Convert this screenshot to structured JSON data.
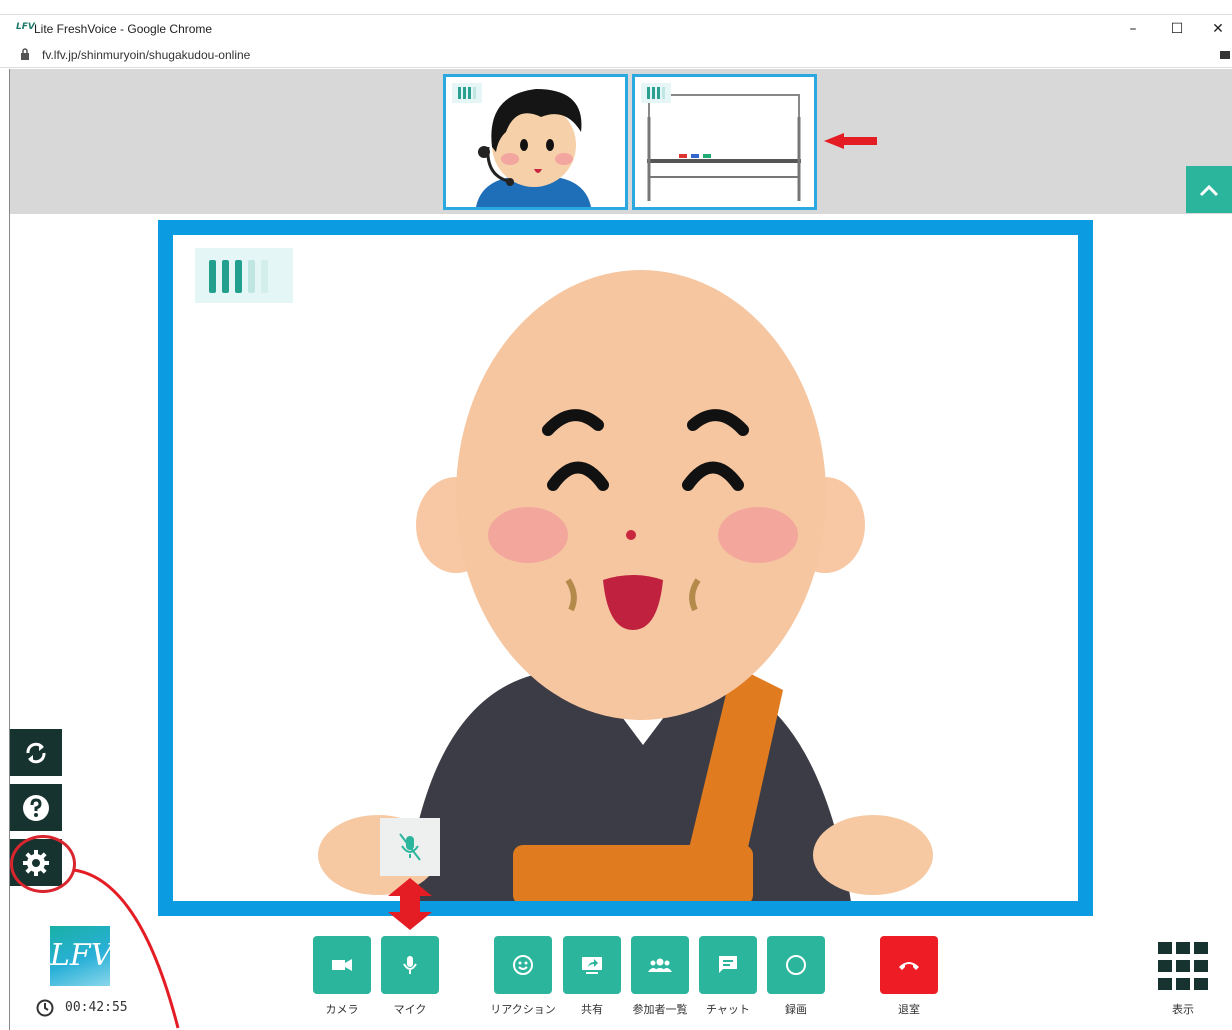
{
  "browser": {
    "window_title": "Lite FreshVoice - Google Chrome",
    "favicon_text": "LFV",
    "url": "fv.lfv.jp/shinmuryoin/shugakudou-online",
    "controls": {
      "minimize": "–",
      "maximize": "☐",
      "close": "✕"
    }
  },
  "participants": {
    "thumbnails": [
      {
        "name": "headset-participant"
      },
      {
        "name": "whiteboard-share"
      }
    ]
  },
  "main_speaker": {
    "name": "monk-speaker"
  },
  "sidebar": {
    "items": [
      {
        "name": "switch-button",
        "icon": "sync-icon"
      },
      {
        "name": "help-button",
        "icon": "help-icon"
      },
      {
        "name": "settings-button",
        "icon": "gear-icon"
      }
    ]
  },
  "footer": {
    "logo_text": "LFV",
    "timer": "00:42:55"
  },
  "toolbar": {
    "camera": "カメラ",
    "mic": "マイク",
    "reaction": "リアクション",
    "share": "共有",
    "participants": "参加者一覧",
    "chat": "チャット",
    "record": "録画",
    "leave": "退室",
    "display": "表示"
  },
  "colors": {
    "accent": "#2bb59d",
    "video_border": "#0a9be0",
    "danger": "#ee1c24",
    "dark": "#17332f",
    "annotation": "#d9252d"
  }
}
